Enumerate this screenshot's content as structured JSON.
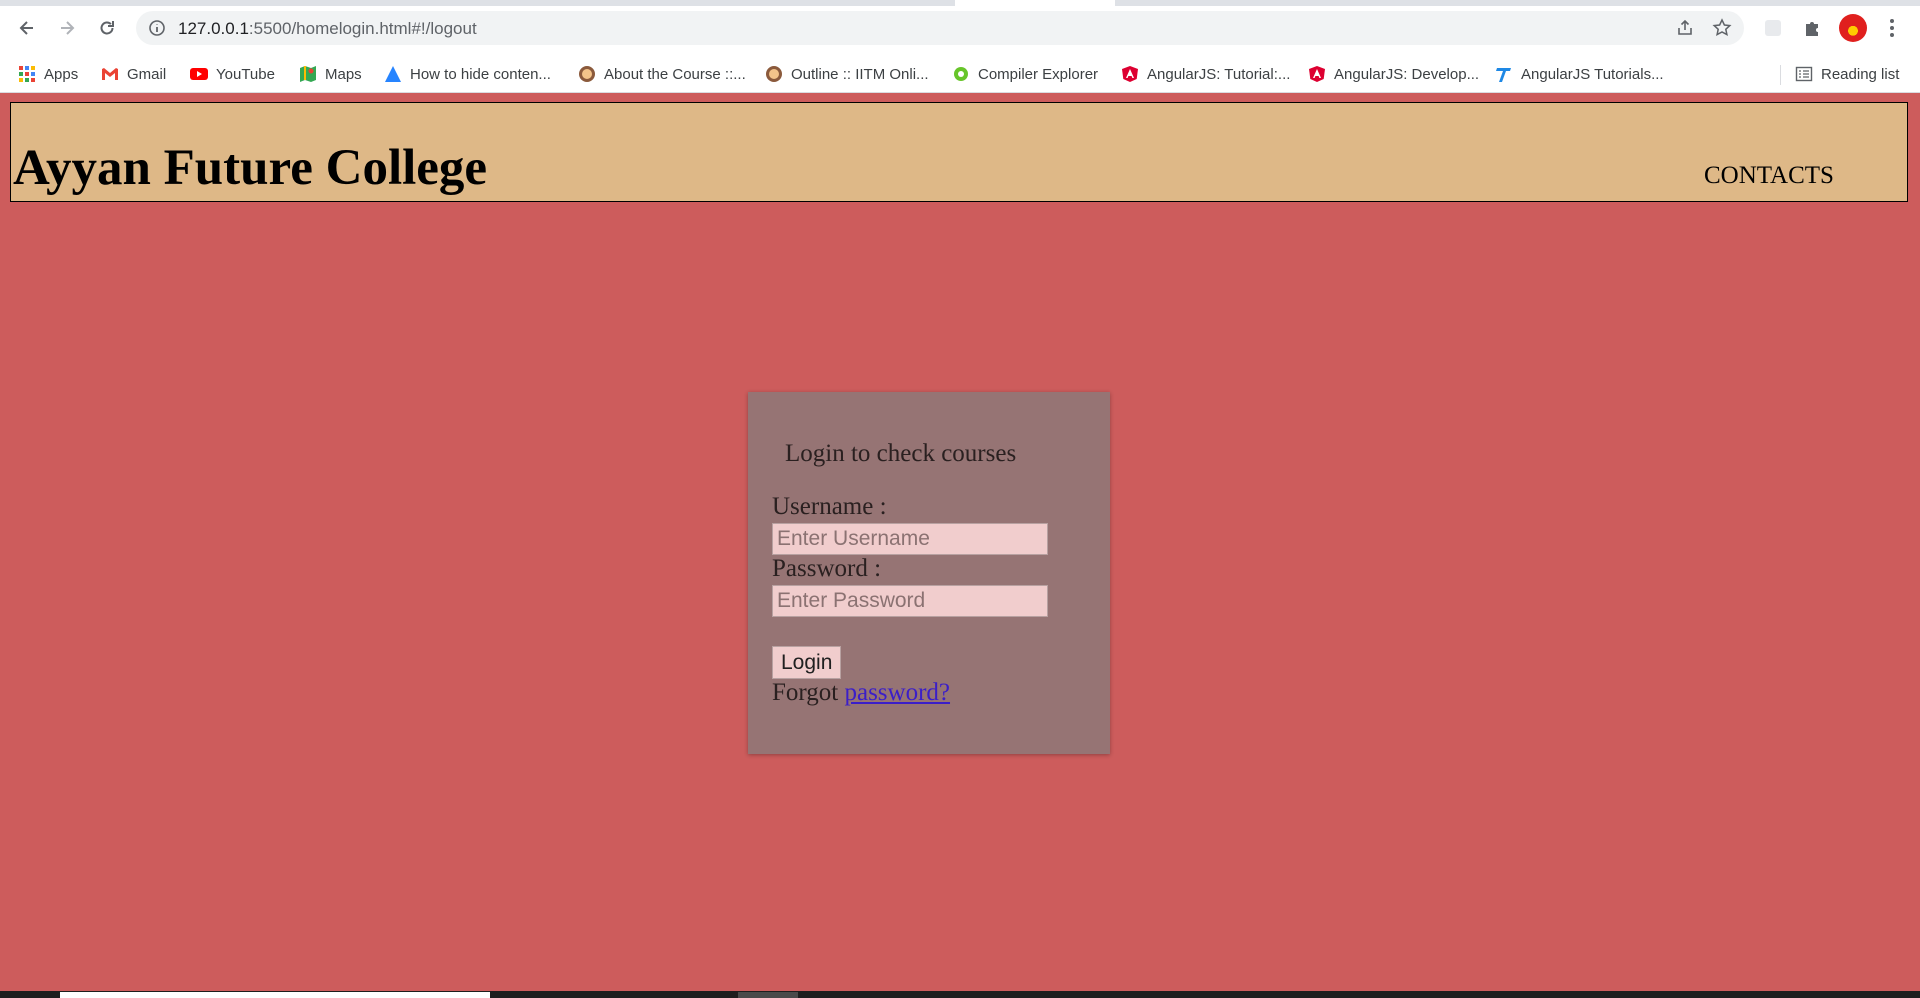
{
  "browser": {
    "url_host": "127.0.0.1",
    "url_path": ":5500/homelogin.html#!/logout",
    "bookmarks": [
      {
        "label": "Apps",
        "icon": "apps-grid-icon"
      },
      {
        "label": "Gmail",
        "icon": "gmail-icon"
      },
      {
        "label": "YouTube",
        "icon": "youtube-icon"
      },
      {
        "label": "Maps",
        "icon": "maps-icon"
      },
      {
        "label": "How to hide conten...",
        "icon": "atlassian-icon"
      },
      {
        "label": "About the Course ::...",
        "icon": "course-icon"
      },
      {
        "label": "Outline :: IITM Onli...",
        "icon": "course-icon"
      },
      {
        "label": "Compiler Explorer",
        "icon": "compiler-explorer-icon"
      },
      {
        "label": "AngularJS: Tutorial:...",
        "icon": "angular-icon"
      },
      {
        "label": "AngularJS: Develop...",
        "icon": "angular-icon"
      },
      {
        "label": "AngularJS Tutorials...",
        "icon": "tutorials-icon"
      }
    ],
    "reading_list": "Reading list"
  },
  "header": {
    "title": "Ayyan Future College",
    "contacts": "CONTACTS"
  },
  "login": {
    "heading": "Login to check courses",
    "username_label": "Username :",
    "username_placeholder": "Enter Username",
    "password_label": "Password :",
    "password_placeholder": "Enter Password",
    "button": "Login",
    "forgot_prefix": "Forgot",
    "forgot_link": "password?"
  },
  "colors": {
    "page_bg": "#cd5c5c",
    "header_bg": "#deb887",
    "card_bg": "#967474",
    "input_bg": "#f1cdcd",
    "link": "#3b1ec8"
  }
}
